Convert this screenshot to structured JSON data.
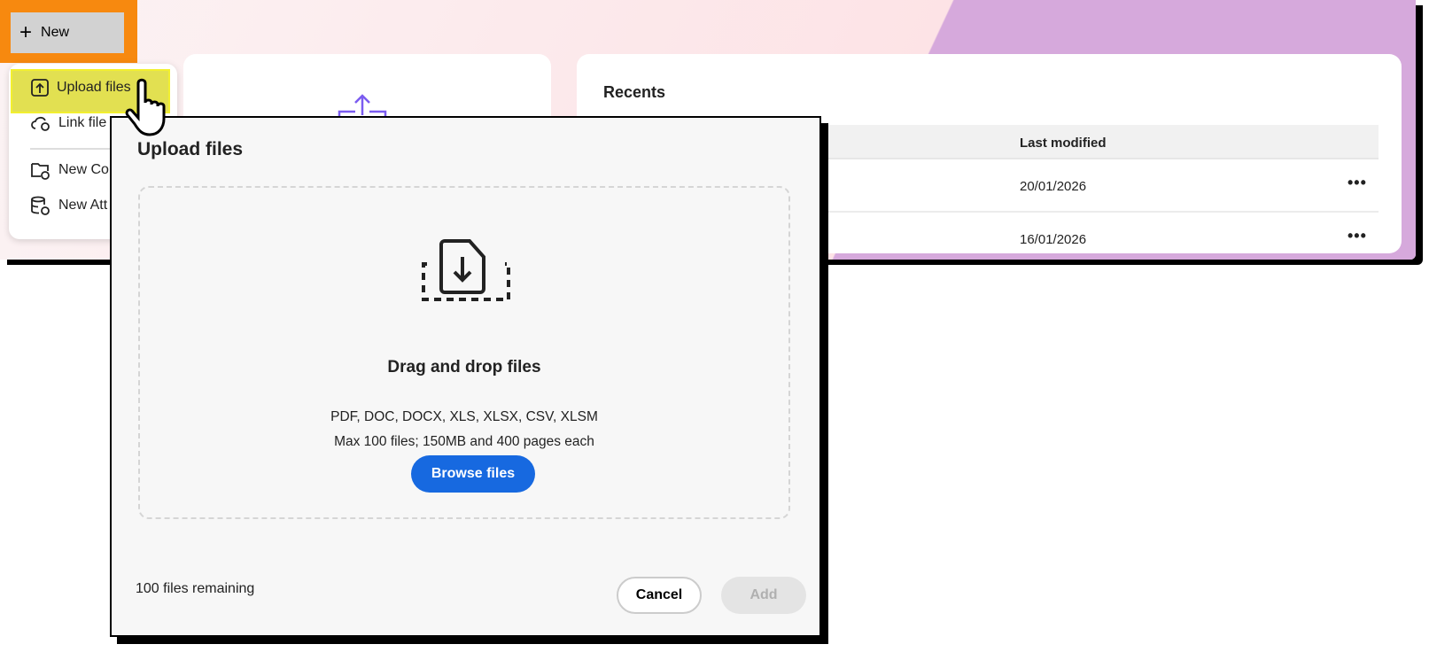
{
  "new_button": {
    "label": "New"
  },
  "menu": {
    "items": [
      {
        "label": "Upload files"
      },
      {
        "label": "Link file"
      },
      {
        "label": "New Co"
      },
      {
        "label": "New Att"
      }
    ]
  },
  "recents": {
    "title": "Recents",
    "column": "Last modified",
    "rows": [
      {
        "date": "20/01/2026",
        "more": "•••"
      },
      {
        "date": "16/01/2026",
        "more": "•••"
      }
    ]
  },
  "dialog": {
    "title": "Upload files",
    "drop_title": "Drag and drop files",
    "types": "PDF, DOC, DOCX, XLS, XLSX, CSV, XLSM",
    "limits": "Max 100 files; 150MB and 400 pages each",
    "browse": "Browse files",
    "remaining": "100 files remaining",
    "cancel": "Cancel",
    "add": "Add"
  },
  "colors": {
    "highlight_new": "#f7890f",
    "highlight_upload": "#e2e051",
    "accent": "#1769e0"
  }
}
